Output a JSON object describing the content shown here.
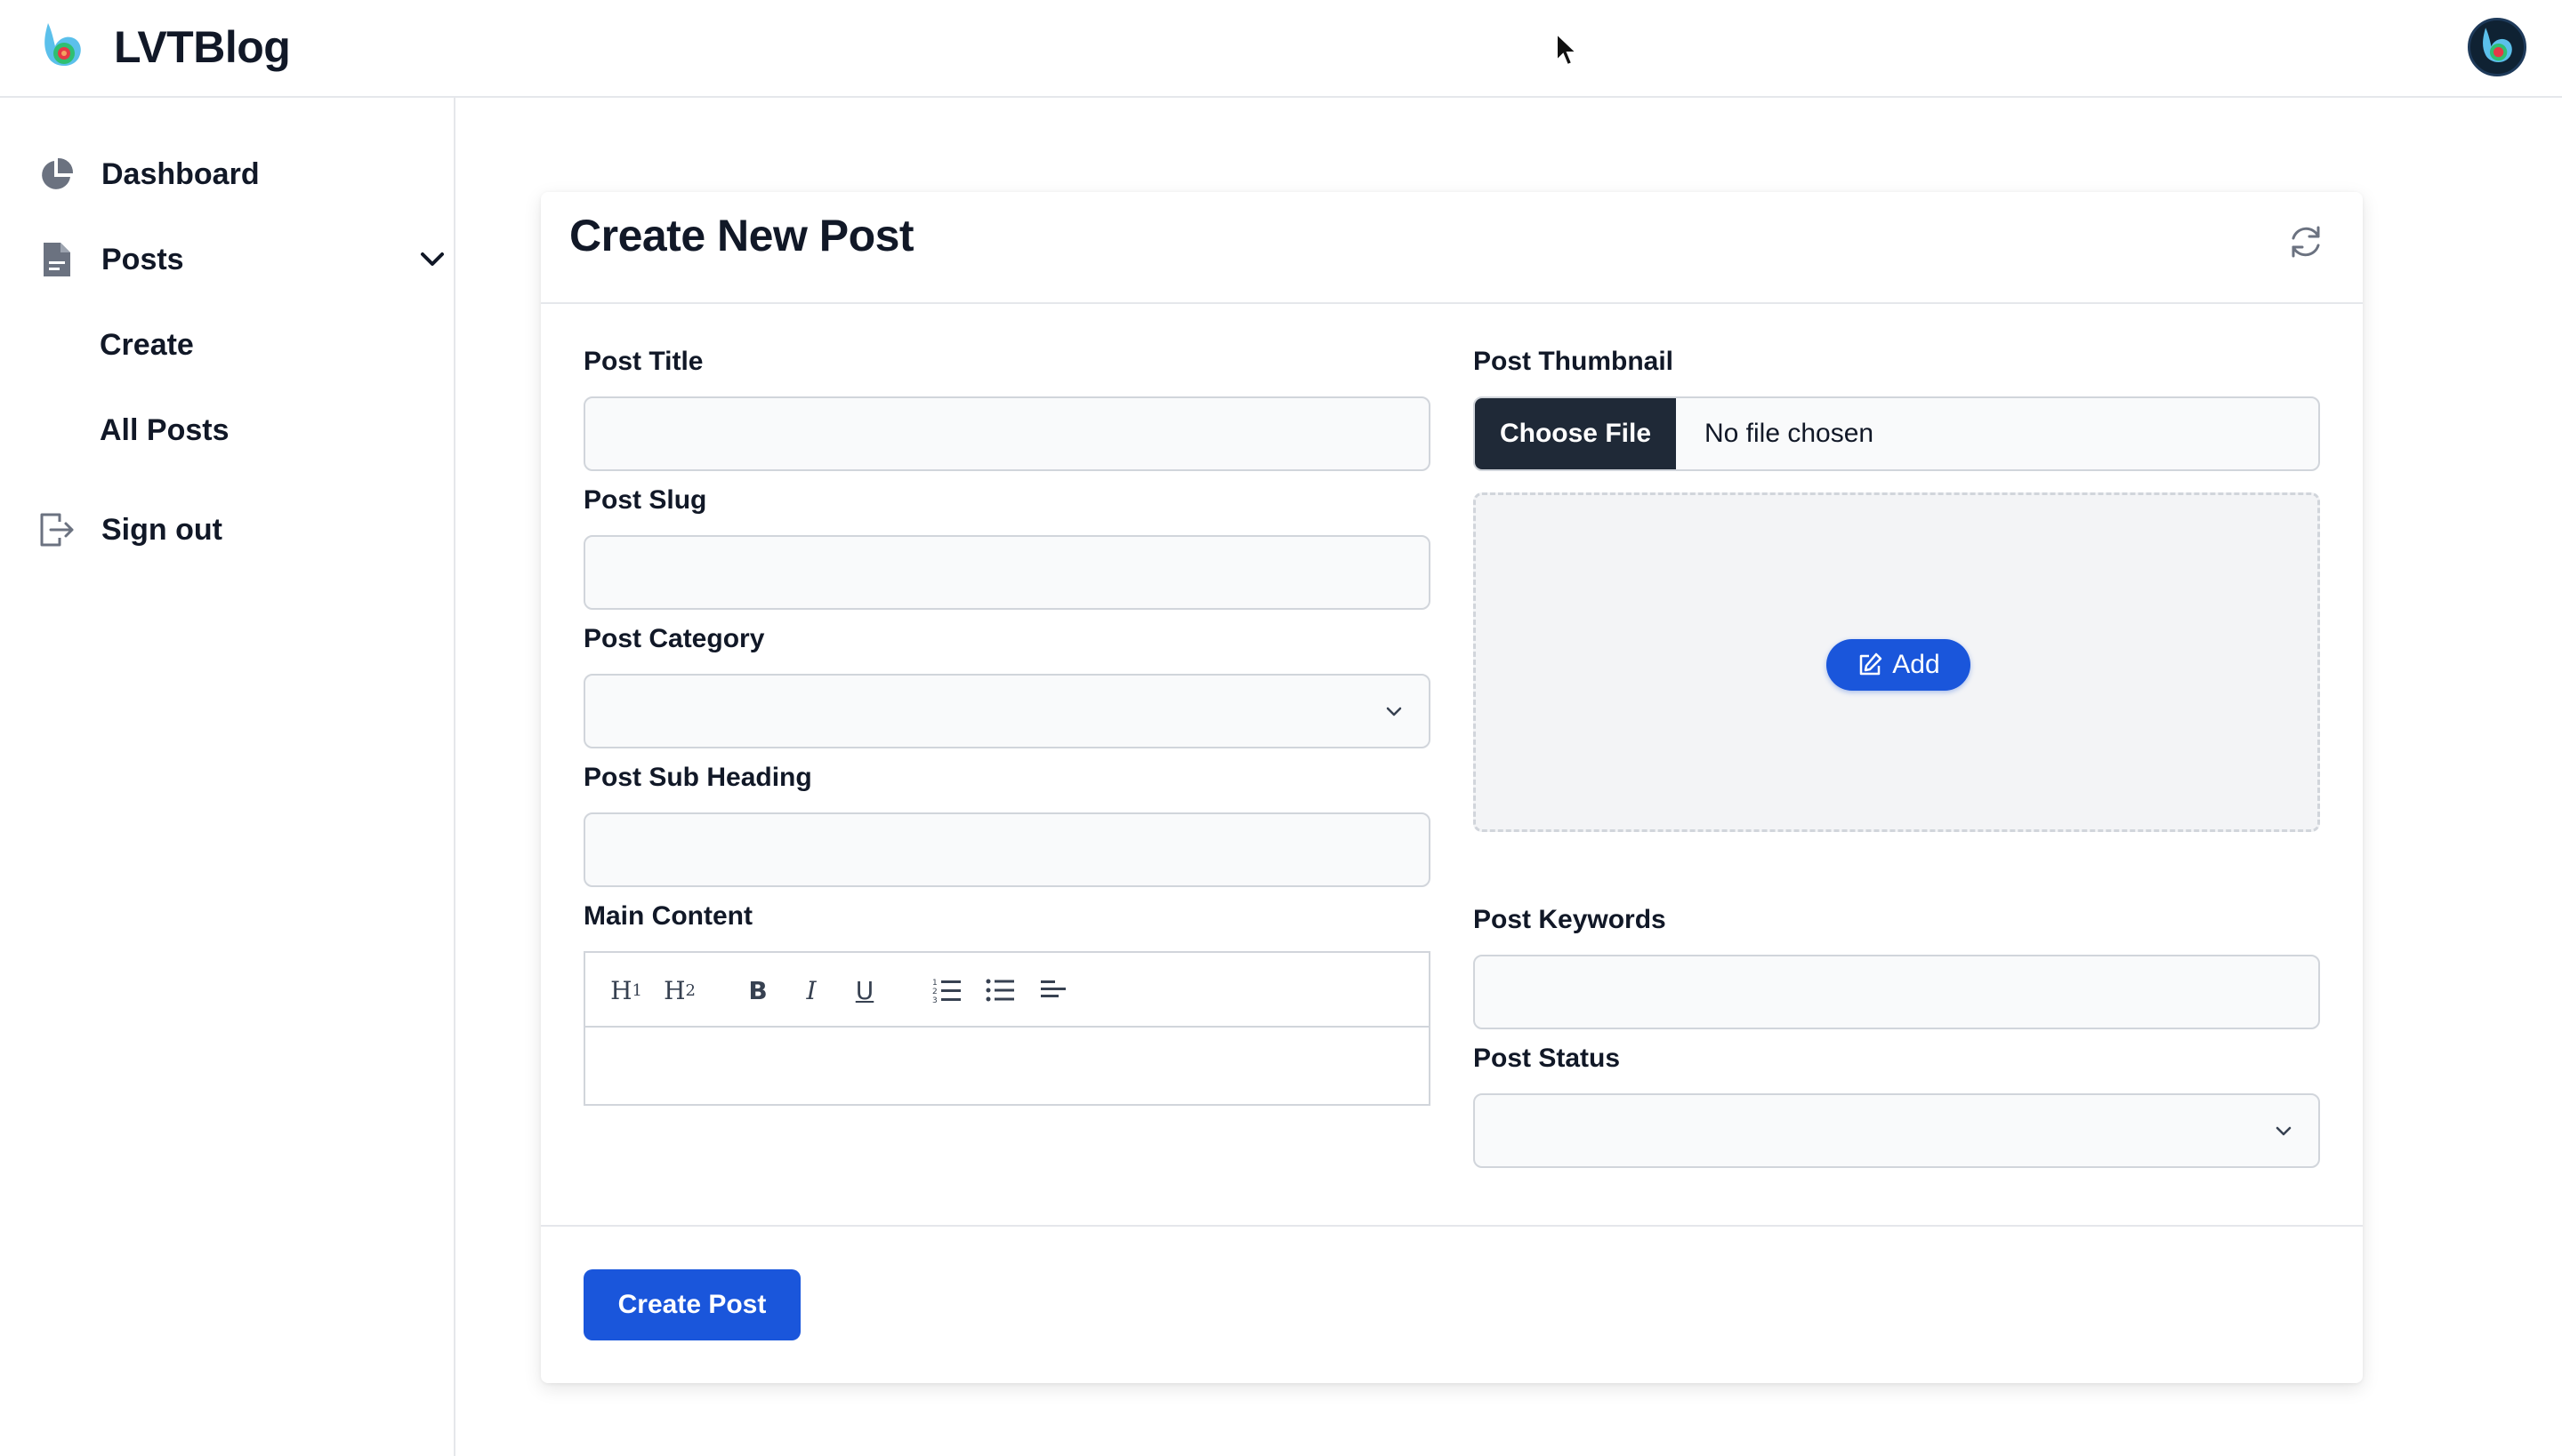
{
  "brand": {
    "name": "LVTBlog"
  },
  "sidebar": {
    "dashboard": "Dashboard",
    "posts": "Posts",
    "create": "Create",
    "all_posts": "All Posts",
    "sign_out": "Sign out"
  },
  "form": {
    "title": "Create New Post",
    "post_title": {
      "label": "Post Title",
      "value": ""
    },
    "post_slug": {
      "label": "Post Slug",
      "value": ""
    },
    "post_category": {
      "label": "Post Category",
      "value": ""
    },
    "post_sub_heading": {
      "label": "Post Sub Heading",
      "value": ""
    },
    "main_content": {
      "label": "Main Content",
      "toolbar": {
        "h1": "H",
        "h1_sub": "1",
        "h2": "H",
        "h2_sub": "2",
        "bold": "B",
        "italic": "I",
        "underline": "U"
      }
    },
    "post_thumbnail": {
      "label": "Post Thumbnail",
      "choose_file": "Choose File",
      "status": "No file chosen",
      "add": "Add"
    },
    "post_keywords": {
      "label": "Post Keywords",
      "value": ""
    },
    "post_status": {
      "label": "Post Status",
      "value": ""
    },
    "submit": "Create Post"
  },
  "colors": {
    "primary": "#1a56db",
    "dark": "#1f2937",
    "border": "#d1d5db",
    "input_bg": "#f9fafb"
  }
}
